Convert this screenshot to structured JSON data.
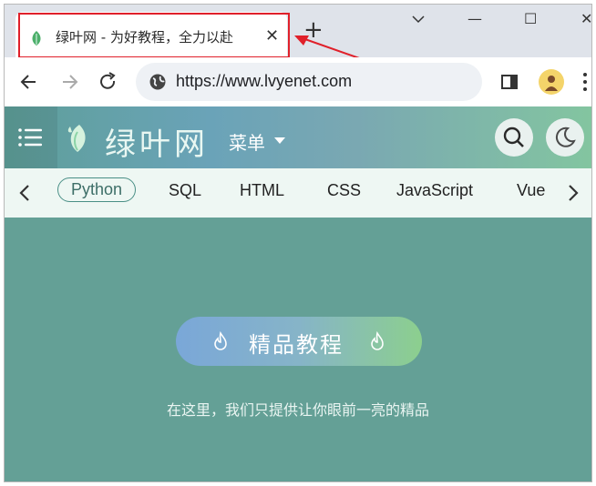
{
  "browser": {
    "tab": {
      "title": "绿叶网 - 为好教程，全力以赴",
      "close": "✕"
    },
    "new_tab": "+",
    "window": {
      "minimize": "—",
      "maximize": "☐",
      "close": "✕"
    },
    "address": {
      "url": "https://www.lvyenet.com"
    }
  },
  "site": {
    "brand": "绿叶网",
    "menu_label": "菜单",
    "categories": [
      "Python",
      "SQL",
      "HTML",
      "CSS",
      "JavaScript",
      "Vue"
    ],
    "active_category": "Python"
  },
  "hero": {
    "button_label": "精品教程",
    "subtitle": "在这里，我们只提供让你眼前一亮的精品"
  },
  "colors": {
    "tabstrip": "#dfe3ea",
    "highlight": "#e0202a",
    "hero_bg": "#64a096",
    "catbar_bg": "#eef7f3"
  }
}
